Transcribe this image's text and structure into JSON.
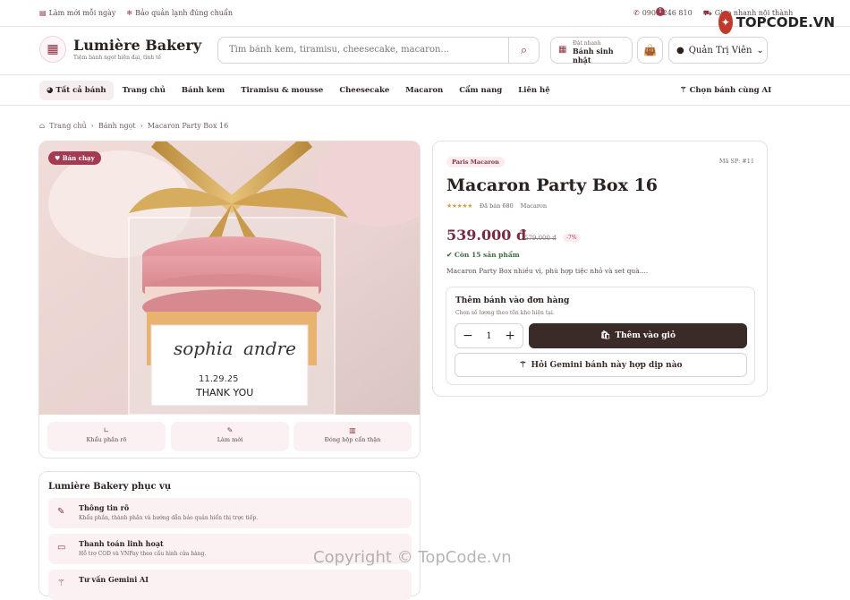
{
  "topbar": {
    "left": [
      "Làm mới mỗi ngày",
      "Bảo quản lạnh đúng chuẩn"
    ],
    "phone": "0908 246 810",
    "delivery": "Giao nhanh nội thành"
  },
  "header": {
    "brand": "Lumière Bakery",
    "tagline": "Tiệm bánh ngọt hiện đại, tinh tế",
    "search_placeholder": "Tìm bánh kem, tiramisu, cheesecake, macaron...",
    "order_small": "Đặt nhanh",
    "order_label": "Bánh sinh nhật",
    "cart_count": "1",
    "user": "Quản Trị Viên"
  },
  "nav": {
    "items": [
      "Tất cả bánh",
      "Trang chủ",
      "Bánh kem",
      "Tiramisu & mousse",
      "Cheesecake",
      "Macaron",
      "Cẩm nang",
      "Liên hệ"
    ],
    "ai": "Chọn bánh cùng AI"
  },
  "breadcrumb": [
    "Trang chủ",
    "Bánh ngọt",
    "Macaron Party Box 16"
  ],
  "gallery": {
    "badge": "Bán chạy",
    "card_text": [
      "sophia",
      "andre",
      "11.29.25",
      "THANK YOU"
    ],
    "features": [
      "Khẩu phần rõ",
      "Làm mới",
      "Đóng hộp cẩn thận"
    ]
  },
  "product": {
    "tag": "Paris Macaron",
    "sku": "Mã SP: #11",
    "title": "Macaron Party Box 16",
    "rating": 5,
    "sold": "Đã bán 680",
    "category": "Macaron",
    "price": "539.000 đ",
    "old_price": "579.000 đ",
    "discount": "-7%",
    "stock": "Còn 15 sản phẩm",
    "description": "Macaron Party Box nhiều vị, phù hợp tiệc nhỏ và set quà....",
    "add_title": "Thêm bánh vào đơn hàng",
    "add_sub": "Chọn số lượng theo tồn kho hiện tại.",
    "qty": "1",
    "add_button": "Thêm vào giỏ",
    "ai_button": "Hỏi Gemini bánh này hợp dịp nào"
  },
  "serve": {
    "title": "Lumière Bakery phục vụ",
    "rows": [
      {
        "title": "Thông tin rõ",
        "desc": "Khẩu phần, thành phần và hướng dẫn bảo quản hiển thị trực tiếp."
      },
      {
        "title": "Thanh toán linh hoạt",
        "desc": "Hỗ trợ COD và VNPay theo cấu hình cửa hàng."
      },
      {
        "title": "Tư vấn Gemini AI",
        "desc": ""
      }
    ]
  },
  "watermarks": {
    "image": "TopCode.vn",
    "page": "Copyright © TopCode.vn",
    "logo": "TOPCODE.VN"
  },
  "colors": {
    "accent": "#8b2e42",
    "dark_button": "#3a2a28",
    "soft_pink": "#fcf1f2"
  }
}
